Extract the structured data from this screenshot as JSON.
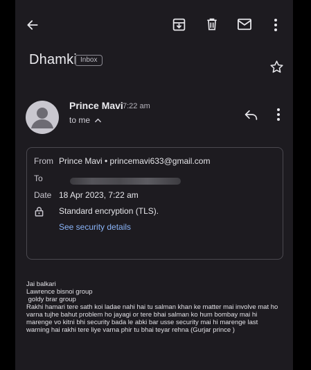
{
  "toolbar": {
    "back_icon": "arrow-left-icon",
    "archive_icon": "archive-icon",
    "delete_icon": "trash-icon",
    "mark_unread_icon": "mail-icon",
    "more_icon": "more-vert-icon"
  },
  "email": {
    "subject": "Dhamki",
    "label": "Inbox",
    "sender_name": "Prince Mavi",
    "time": "7:22 am",
    "recipient_summary": "to me",
    "reply_icon": "reply-icon"
  },
  "details": {
    "from_label": "From",
    "from_value": "Prince Mavi • princemavi633@gmail.com",
    "to_label": "To",
    "date_label": "Date",
    "date_value": "18 Apr 2023, 7:22 am",
    "encryption_text": "Standard encryption (TLS).",
    "security_link": "See security details"
  },
  "body": {
    "lines": [
      "Jai balkari",
      "Lawrence bisnoi group",
      " goldy brar group",
      "Rakhi hamari tere sath koi ladae nahi hai tu salman khan ke matter mai involve mat ho",
      "varna tujhe bahut problem ho jayagi or tere bhai salman ko hum bombay mai hi",
      "marenge vo kitni bhi security bada le abki bar usse security mai hi marenge last",
      "warning hai rakhi tere liye varna phir tu bhai teyar rehna (Gurjar prince )"
    ]
  },
  "colors": {
    "background": "#1d1b20",
    "link": "#8ab4f8",
    "card_border": "#4b4950"
  }
}
